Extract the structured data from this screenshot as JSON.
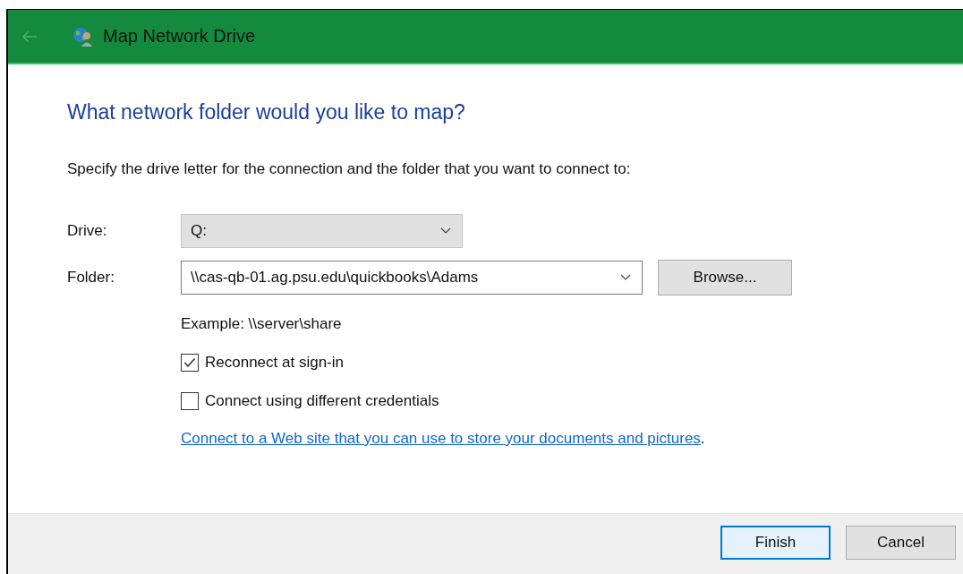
{
  "window": {
    "title": "Map Network Drive"
  },
  "heading": "What network folder would you like to map?",
  "instruction": "Specify the drive letter for the connection and the folder that you want to connect to:",
  "drive": {
    "label": "Drive:",
    "value": "Q:"
  },
  "folder": {
    "label": "Folder:",
    "value": "\\\\cas-qb-01.ag.psu.edu\\quickbooks\\Adams",
    "browse": "Browse..."
  },
  "example": "Example: \\\\server\\share",
  "options": [
    {
      "label": "Reconnect at sign-in",
      "checked": true
    },
    {
      "label": "Connect using different credentials",
      "checked": false
    }
  ],
  "link": {
    "text": "Connect to a Web site that you can use to store your documents and pictures",
    "after": "."
  },
  "buttons": [
    {
      "label": "Finish",
      "default": true
    },
    {
      "label": "Cancel",
      "default": false
    }
  ]
}
